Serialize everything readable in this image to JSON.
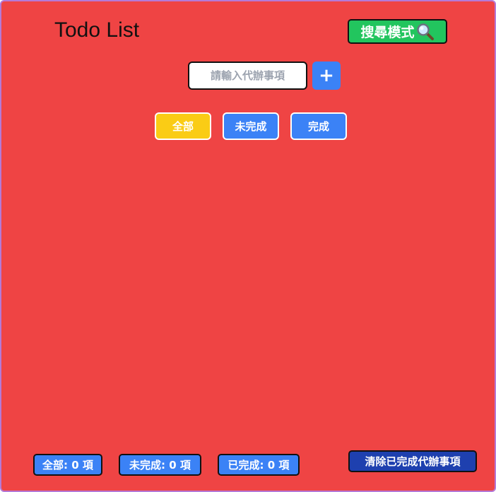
{
  "header": {
    "title": "Todo List",
    "search_mode_label": "搜尋模式"
  },
  "input": {
    "placeholder": "請輸入代辦事項",
    "value": "",
    "add_label": "+"
  },
  "filters": {
    "all": "全部",
    "undone": "未完成",
    "done": "完成"
  },
  "footer": {
    "count_all": "全部: 0 項",
    "count_undone": "未完成: 0 項",
    "count_done": "已完成: 0 項",
    "clear_label": "清除已完成代辦事項"
  },
  "colors": {
    "background": "#ef4444",
    "search_mode": "#22c55e",
    "active_filter": "#facc15",
    "button_blue": "#3b82f6",
    "clear_button": "#1e40af"
  },
  "icons": {
    "search_mode": "magnifier-icon",
    "add": "plus-icon"
  }
}
